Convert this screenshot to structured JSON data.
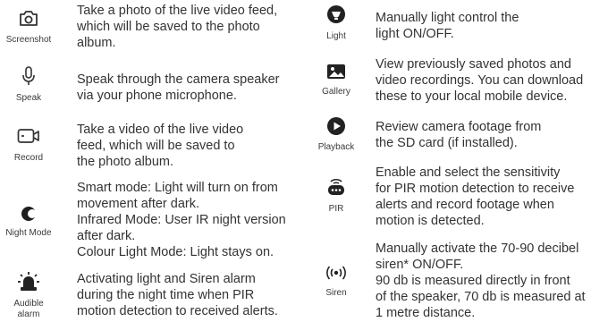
{
  "left": [
    {
      "label": "Screenshot",
      "icon": "camera-icon",
      "lines": [
        "Take a photo of the live video feed,",
        "which will be saved to the photo",
        "album."
      ]
    },
    {
      "label": "Speak",
      "icon": "microphone-icon",
      "lines": [
        "Speak through the camera speaker",
        "via your phone microphone."
      ]
    },
    {
      "label": "Record",
      "icon": "video-camera-icon",
      "lines": [
        "Take a video of the live video",
        "feed, which will be saved to",
        "the photo album."
      ]
    },
    {
      "label": "Night Mode",
      "icon": "moon-icon",
      "lines": [
        "Smart mode: Light will turn on from",
        "movement after dark.",
        "Infrared Mode: User IR night version",
        "after dark.",
        "Colour Light Mode: Light stays on."
      ]
    },
    {
      "label1": "Audible",
      "label2": "alarm",
      "icon": "siren-icon",
      "lines": [
        "Activating light and Siren alarm",
        "during the night time when PIR",
        "motion detection to received alerts."
      ]
    }
  ],
  "right": [
    {
      "label": "Light",
      "icon": "light-bulb-icon",
      "lines": [
        "Manually light control the",
        "light ON/OFF."
      ]
    },
    {
      "label": "Gallery",
      "icon": "gallery-icon",
      "lines": [
        "View previously saved photos and",
        "video recordings. You can download",
        "these to your local mobile device."
      ]
    },
    {
      "label": "Playback",
      "icon": "play-icon",
      "lines": [
        "Review camera footage from",
        "the SD card (if installed)."
      ]
    },
    {
      "label": "PIR",
      "icon": "pir-sensor-icon",
      "lines": [
        "Enable and select the sensitivity",
        "for PIR motion detection to receive",
        "alerts and record footage when",
        "motion is detected."
      ]
    },
    {
      "label": "Siren",
      "icon": "broadcast-icon",
      "lines": [
        "Manually activate the 70-90 decibel",
        "siren* ON/OFF.",
        "90 db is measured directly in front",
        "of the speaker, 70 db is measured at",
        "1 metre distance."
      ]
    }
  ]
}
